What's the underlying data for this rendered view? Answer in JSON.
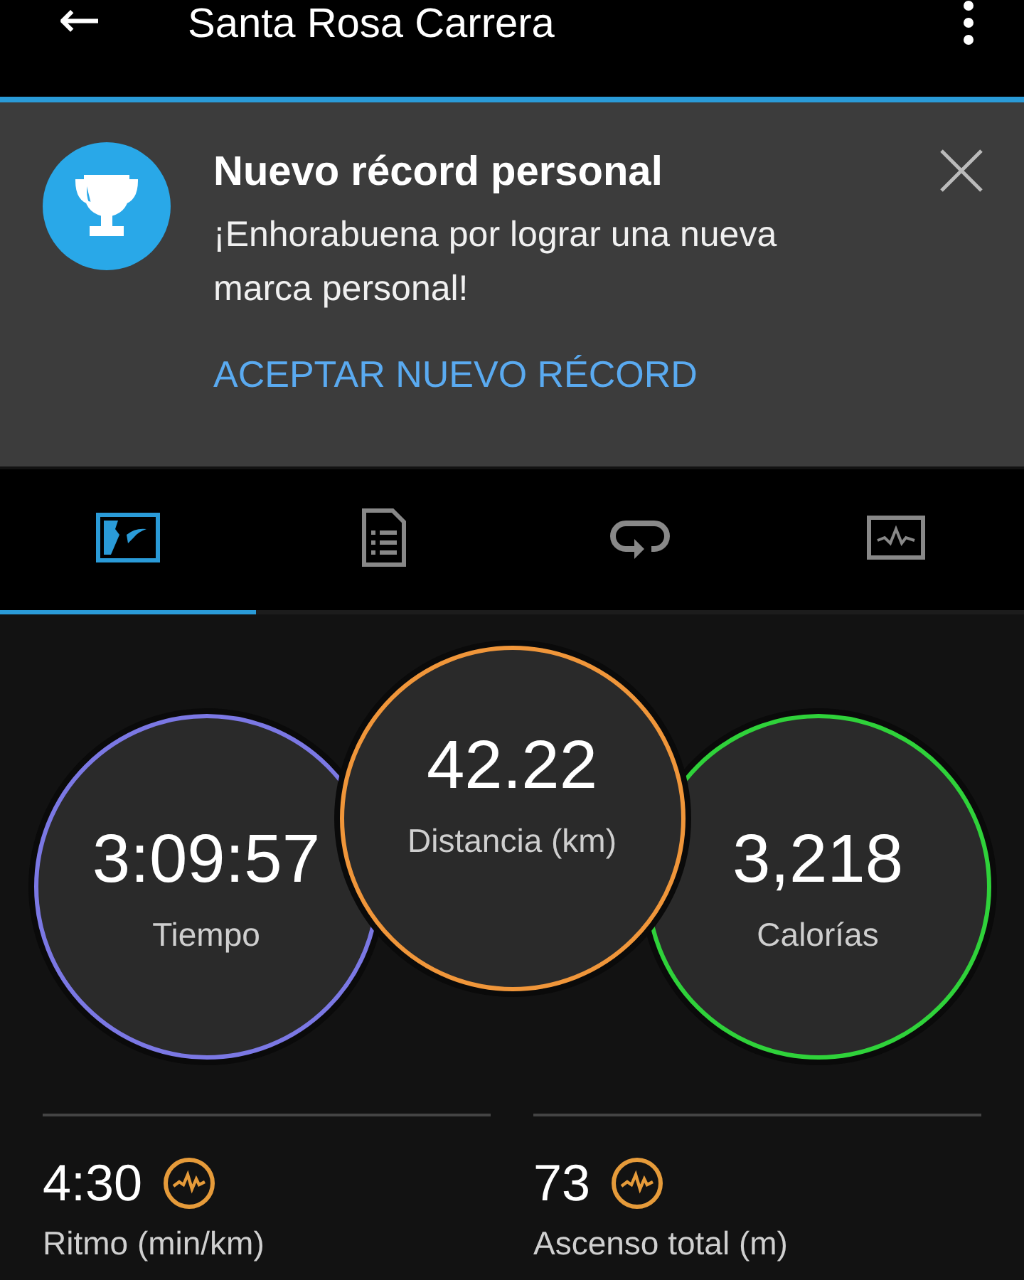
{
  "app_bar": {
    "back": "←",
    "title": "Santa Rosa Carrera"
  },
  "banner": {
    "title": "Nuevo récord personal",
    "message": "¡Enhorabuena por lograr una nueva marca personal!",
    "action": "ACEPTAR NUEVO RÉCORD"
  },
  "tabs": [
    {
      "kind": "stats",
      "selected": true
    },
    {
      "kind": "details",
      "selected": false
    },
    {
      "kind": "laps",
      "selected": false
    },
    {
      "kind": "charts",
      "selected": false
    }
  ],
  "rings": [
    {
      "value": "3:09:57",
      "label": "Tiempo",
      "color": "#7b78e4"
    },
    {
      "value": "42.22",
      "label": "Distancia (km)",
      "color": "#f0963a"
    },
    {
      "value": "3,218",
      "label": "Calorías",
      "color": "#2fd23a"
    }
  ],
  "stats": [
    {
      "value": "4:30",
      "label": "Ritmo (min/km)"
    },
    {
      "value": "73",
      "label": "Ascenso total (m)"
    }
  ]
}
